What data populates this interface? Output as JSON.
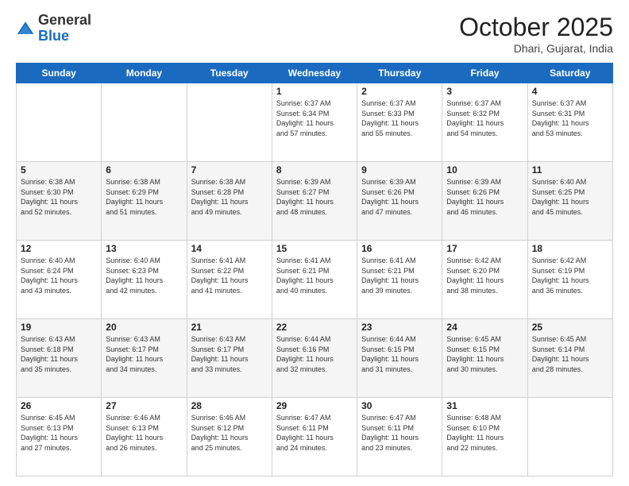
{
  "header": {
    "logo_general": "General",
    "logo_blue": "Blue",
    "month": "October 2025",
    "location": "Dhari, Gujarat, India"
  },
  "weekdays": [
    "Sunday",
    "Monday",
    "Tuesday",
    "Wednesday",
    "Thursday",
    "Friday",
    "Saturday"
  ],
  "weeks": [
    [
      {
        "day": "",
        "info": ""
      },
      {
        "day": "",
        "info": ""
      },
      {
        "day": "",
        "info": ""
      },
      {
        "day": "1",
        "info": "Sunrise: 6:37 AM\nSunset: 6:34 PM\nDaylight: 11 hours\nand 57 minutes."
      },
      {
        "day": "2",
        "info": "Sunrise: 6:37 AM\nSunset: 6:33 PM\nDaylight: 11 hours\nand 55 minutes."
      },
      {
        "day": "3",
        "info": "Sunrise: 6:37 AM\nSunset: 6:32 PM\nDaylight: 11 hours\nand 54 minutes."
      },
      {
        "day": "4",
        "info": "Sunrise: 6:37 AM\nSunset: 6:31 PM\nDaylight: 11 hours\nand 53 minutes."
      }
    ],
    [
      {
        "day": "5",
        "info": "Sunrise: 6:38 AM\nSunset: 6:30 PM\nDaylight: 11 hours\nand 52 minutes."
      },
      {
        "day": "6",
        "info": "Sunrise: 6:38 AM\nSunset: 6:29 PM\nDaylight: 11 hours\nand 51 minutes."
      },
      {
        "day": "7",
        "info": "Sunrise: 6:38 AM\nSunset: 6:28 PM\nDaylight: 11 hours\nand 49 minutes."
      },
      {
        "day": "8",
        "info": "Sunrise: 6:39 AM\nSunset: 6:27 PM\nDaylight: 11 hours\nand 48 minutes."
      },
      {
        "day": "9",
        "info": "Sunrise: 6:39 AM\nSunset: 6:26 PM\nDaylight: 11 hours\nand 47 minutes."
      },
      {
        "day": "10",
        "info": "Sunrise: 6:39 AM\nSunset: 6:26 PM\nDaylight: 11 hours\nand 46 minutes."
      },
      {
        "day": "11",
        "info": "Sunrise: 6:40 AM\nSunset: 6:25 PM\nDaylight: 11 hours\nand 45 minutes."
      }
    ],
    [
      {
        "day": "12",
        "info": "Sunrise: 6:40 AM\nSunset: 6:24 PM\nDaylight: 11 hours\nand 43 minutes."
      },
      {
        "day": "13",
        "info": "Sunrise: 6:40 AM\nSunset: 6:23 PM\nDaylight: 11 hours\nand 42 minutes."
      },
      {
        "day": "14",
        "info": "Sunrise: 6:41 AM\nSunset: 6:22 PM\nDaylight: 11 hours\nand 41 minutes."
      },
      {
        "day": "15",
        "info": "Sunrise: 6:41 AM\nSunset: 6:21 PM\nDaylight: 11 hours\nand 40 minutes."
      },
      {
        "day": "16",
        "info": "Sunrise: 6:41 AM\nSunset: 6:21 PM\nDaylight: 11 hours\nand 39 minutes."
      },
      {
        "day": "17",
        "info": "Sunrise: 6:42 AM\nSunset: 6:20 PM\nDaylight: 11 hours\nand 38 minutes."
      },
      {
        "day": "18",
        "info": "Sunrise: 6:42 AM\nSunset: 6:19 PM\nDaylight: 11 hours\nand 36 minutes."
      }
    ],
    [
      {
        "day": "19",
        "info": "Sunrise: 6:43 AM\nSunset: 6:18 PM\nDaylight: 11 hours\nand 35 minutes."
      },
      {
        "day": "20",
        "info": "Sunrise: 6:43 AM\nSunset: 6:17 PM\nDaylight: 11 hours\nand 34 minutes."
      },
      {
        "day": "21",
        "info": "Sunrise: 6:43 AM\nSunset: 6:17 PM\nDaylight: 11 hours\nand 33 minutes."
      },
      {
        "day": "22",
        "info": "Sunrise: 6:44 AM\nSunset: 6:16 PM\nDaylight: 11 hours\nand 32 minutes."
      },
      {
        "day": "23",
        "info": "Sunrise: 6:44 AM\nSunset: 6:15 PM\nDaylight: 11 hours\nand 31 minutes."
      },
      {
        "day": "24",
        "info": "Sunrise: 6:45 AM\nSunset: 6:15 PM\nDaylight: 11 hours\nand 30 minutes."
      },
      {
        "day": "25",
        "info": "Sunrise: 6:45 AM\nSunset: 6:14 PM\nDaylight: 11 hours\nand 28 minutes."
      }
    ],
    [
      {
        "day": "26",
        "info": "Sunrise: 6:45 AM\nSunset: 6:13 PM\nDaylight: 11 hours\nand 27 minutes."
      },
      {
        "day": "27",
        "info": "Sunrise: 6:46 AM\nSunset: 6:13 PM\nDaylight: 11 hours\nand 26 minutes."
      },
      {
        "day": "28",
        "info": "Sunrise: 6:46 AM\nSunset: 6:12 PM\nDaylight: 11 hours\nand 25 minutes."
      },
      {
        "day": "29",
        "info": "Sunrise: 6:47 AM\nSunset: 6:11 PM\nDaylight: 11 hours\nand 24 minutes."
      },
      {
        "day": "30",
        "info": "Sunrise: 6:47 AM\nSunset: 6:11 PM\nDaylight: 11 hours\nand 23 minutes."
      },
      {
        "day": "31",
        "info": "Sunrise: 6:48 AM\nSunset: 6:10 PM\nDaylight: 11 hours\nand 22 minutes."
      },
      {
        "day": "",
        "info": ""
      }
    ]
  ]
}
